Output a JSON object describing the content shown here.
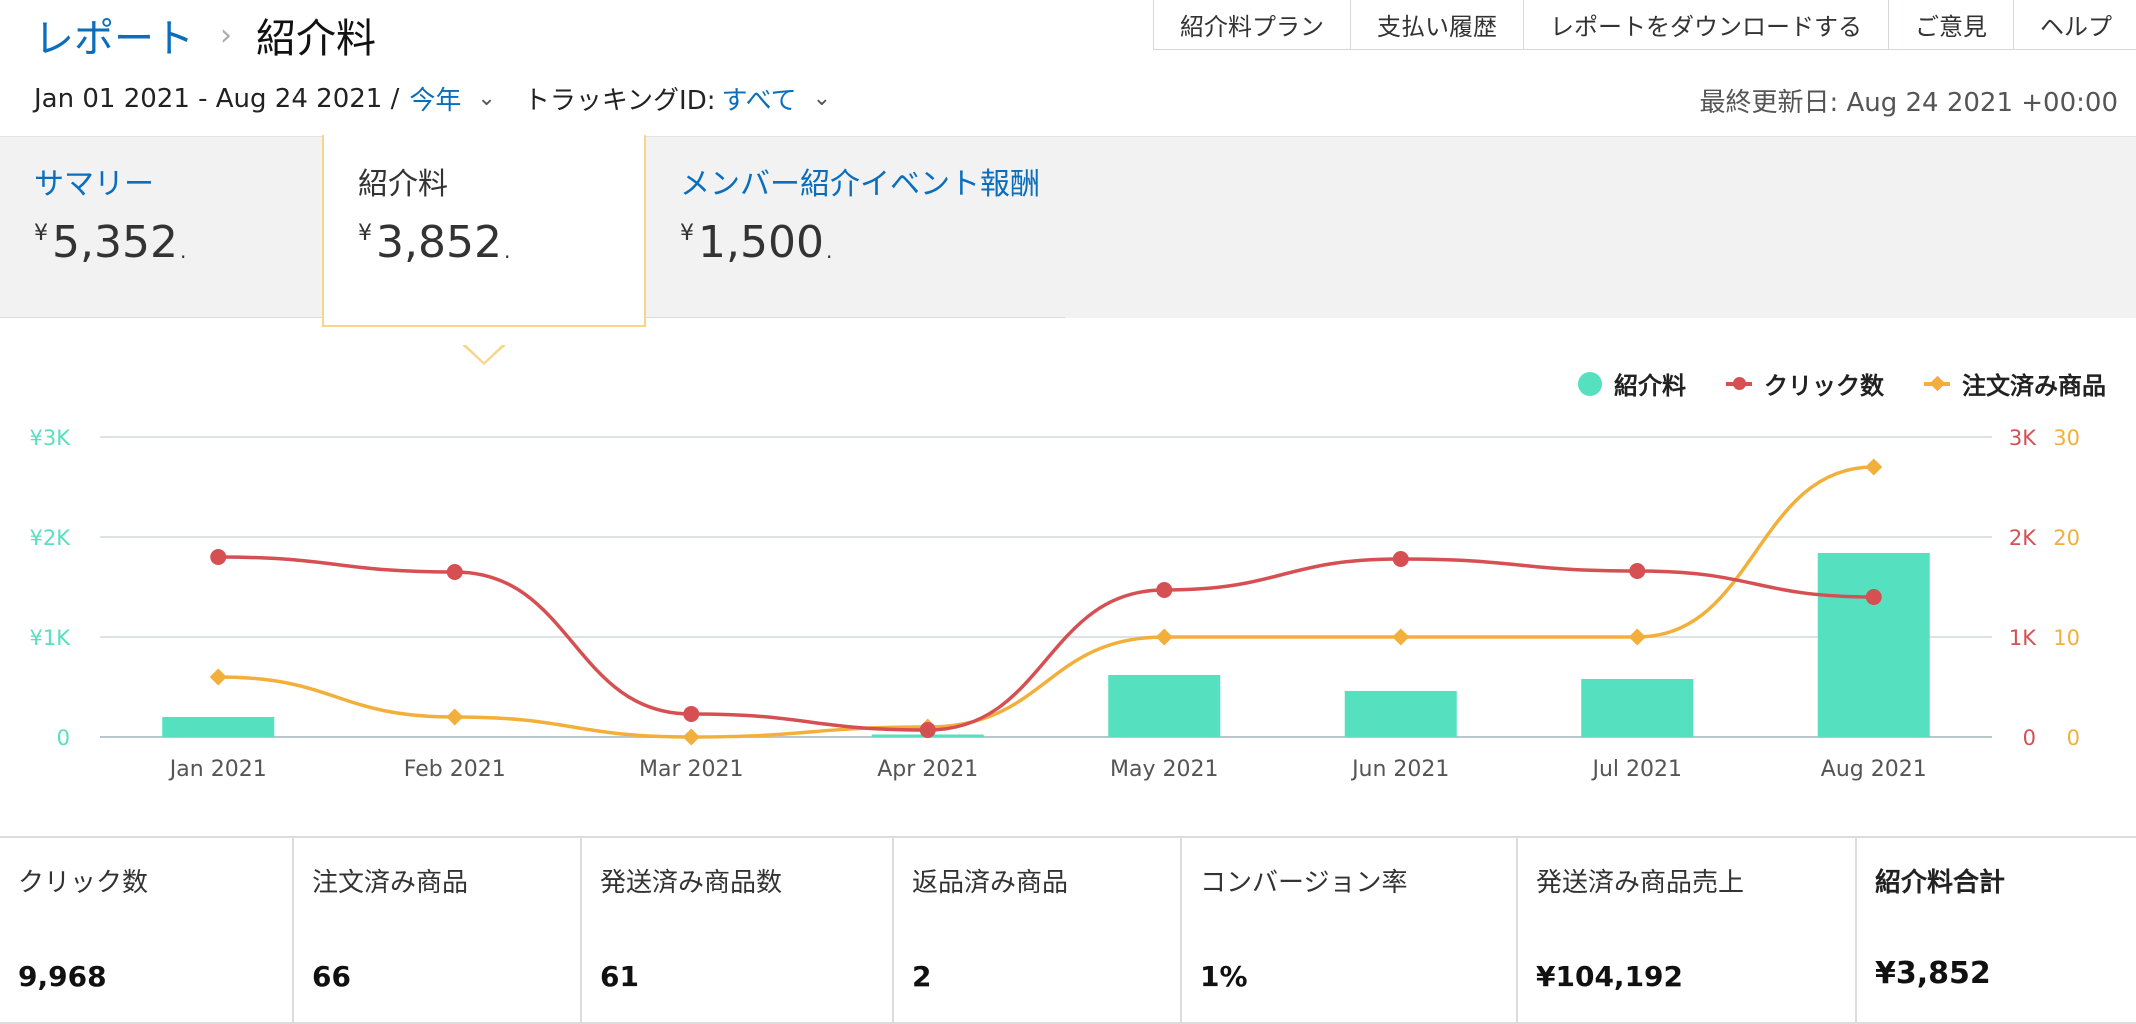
{
  "breadcrumb": {
    "parent": "レポート",
    "separator": "›",
    "current": "紹介料"
  },
  "top_nav": [
    "紹介料プラン",
    "支払い履歴",
    "レポートをダウンロードする",
    "ご意見",
    "ヘルプ"
  ],
  "filters": {
    "date_range": "Jan 01 2021 - Aug 24 2021 /",
    "period_select": "今年",
    "tracking_label": "トラッキングID:",
    "tracking_select": "すべて"
  },
  "last_updated": "最終更新日: Aug 24 2021 +00:00",
  "summary_tabs": {
    "summary": {
      "label": "サマリー",
      "currency": "¥",
      "value": "5,352",
      "suffix": "."
    },
    "referral": {
      "label": "紹介料",
      "currency": "¥",
      "value": "3,852",
      "suffix": "."
    },
    "member": {
      "label": "メンバー紹介イベント報酬",
      "currency": "¥",
      "value": "1,500",
      "suffix": "."
    }
  },
  "legend": {
    "fees": "紹介料",
    "clicks": "クリック数",
    "ordered": "注文済み商品"
  },
  "colors": {
    "fees": "#55e0c0",
    "clicks": "#d64f53",
    "ordered": "#f2b03a",
    "link": "#0a6ebd"
  },
  "chart_data": {
    "type": "bar+line",
    "categories": [
      "Jan 2021",
      "Feb 2021",
      "Mar 2021",
      "Apr 2021",
      "May 2021",
      "Jun 2021",
      "Jul 2021",
      "Aug 2021"
    ],
    "series": [
      {
        "name": "紹介料",
        "kind": "bar",
        "axis": "left",
        "values": [
          200,
          0,
          0,
          25,
          620,
          460,
          580,
          1840
        ]
      },
      {
        "name": "クリック数",
        "kind": "line",
        "axis": "right1",
        "values": [
          1800,
          1650,
          230,
          70,
          1470,
          1780,
          1660,
          1400
        ]
      },
      {
        "name": "注文済み商品",
        "kind": "line",
        "axis": "right2",
        "values": [
          6,
          2,
          0,
          1,
          10,
          10,
          10,
          27
        ]
      }
    ],
    "axes": {
      "left": {
        "ylim": [
          0,
          3000
        ],
        "ticks": [
          "0",
          "¥1K",
          "¥2K",
          "¥3K"
        ]
      },
      "right1": {
        "ylim": [
          0,
          3000
        ],
        "ticks": [
          "0",
          "1K",
          "2K",
          "3K"
        ]
      },
      "right2": {
        "ylim": [
          0,
          30
        ],
        "ticks": [
          "0",
          "10",
          "20",
          "30"
        ]
      }
    },
    "grid": true,
    "legend_position": "top-right"
  },
  "stats": [
    {
      "label": "クリック数",
      "value": "9,968"
    },
    {
      "label": "注文済み商品",
      "value": "66"
    },
    {
      "label": "発送済み商品数",
      "value": "61"
    },
    {
      "label": "返品済み商品",
      "value": "2"
    },
    {
      "label": "コンバージョン率",
      "value": "1%"
    },
    {
      "label": "発送済み商品売上",
      "value": "¥104,192"
    },
    {
      "label": "紹介料合計",
      "value": "¥3,852"
    }
  ]
}
